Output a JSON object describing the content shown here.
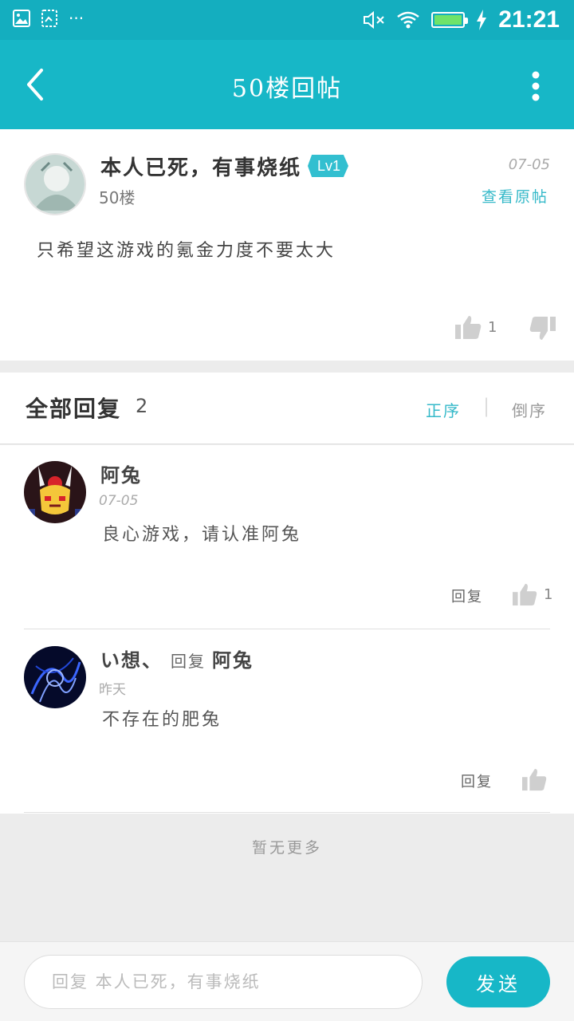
{
  "status_bar": {
    "time": "21:21",
    "icons": [
      "image-icon",
      "screenshot-icon",
      "more-dots-icon",
      "mute-icon",
      "wifi-icon",
      "battery-icon",
      "charging-icon"
    ],
    "battery_color": "#6fe36a"
  },
  "header": {
    "title": "50楼回帖",
    "bg_color": "#17b7c7"
  },
  "post": {
    "author": "本人已死，有事烧纸",
    "level": "Lv1",
    "floor": "50楼",
    "date": "07-05",
    "view_original": "查看原帖",
    "content": "只希望这游戏的氪金力度不要太大",
    "likes": "1"
  },
  "replies_header": {
    "label": "全部回复",
    "count": "2",
    "sort_asc": "正序",
    "separator": "|",
    "sort_desc": "倒序",
    "accent_color": "#35b9c9"
  },
  "replies": [
    {
      "author": "阿兔",
      "date": "07-05",
      "text": "良心游戏，请认准阿兔",
      "reply_label": "回复",
      "likes": "1"
    },
    {
      "author": "い想、",
      "reply_to_label": "回复",
      "reply_to": "阿兔",
      "date": "昨天",
      "text": "不存在的肥兔",
      "reply_label": "回复"
    }
  ],
  "footer": {
    "no_more": "暂无更多"
  },
  "bottom_bar": {
    "placeholder": "回复 本人已死，有事烧纸",
    "send_label": "发送"
  }
}
